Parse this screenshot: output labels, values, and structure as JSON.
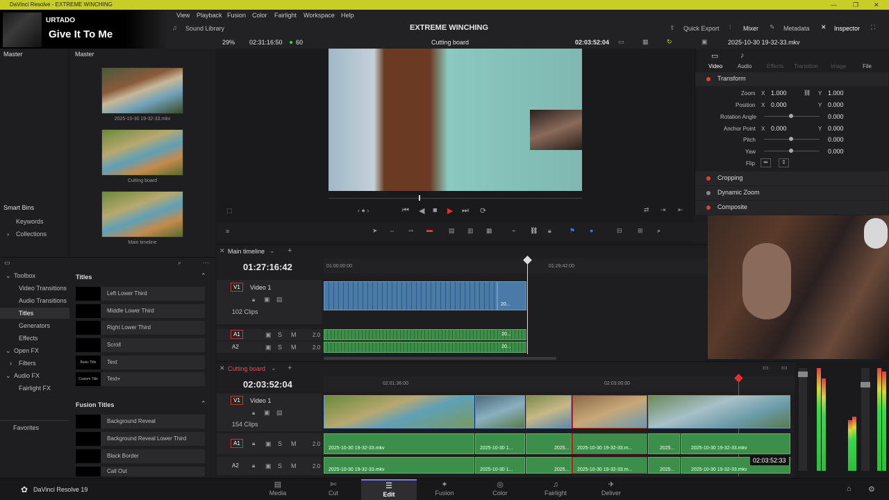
{
  "window": {
    "title": "DaVinci Resolve - EXTREME WINCHING"
  },
  "music": {
    "artist": "URTADO",
    "song": "Give It To Me"
  },
  "menu": {
    "items": [
      "View",
      "Playback",
      "Fusion",
      "Color",
      "Fairlight",
      "Workspace",
      "Help"
    ]
  },
  "toolbar": {
    "sound_library": "Sound Library",
    "project_title": "EXTREME WINCHING",
    "quick_export": "Quick Export",
    "mixer": "Mixer",
    "metadata": "Metadata",
    "inspector": "Inspector"
  },
  "media": {
    "master_left": "Master",
    "master_right": "Master",
    "smart_bins": "Smart Bins",
    "keywords": "Keywords",
    "collections": "Collections",
    "thumbs": [
      "2025-10-30 19-32-33.mkv",
      "Cutting board",
      "Main timeline"
    ]
  },
  "viewer": {
    "zoom": "29%",
    "source_tc": "02:31:16:50",
    "fps": "60",
    "name": "Cutting board",
    "record_tc": "02:03:52:04",
    "clip_name": "2025-10-30 19-32-33.mkv"
  },
  "inspector": {
    "tabs": [
      "Video",
      "Audio",
      "Effects",
      "Transition",
      "Image",
      "File"
    ],
    "sections": [
      "Transform",
      "Cropping",
      "Dynamic Zoom",
      "Composite"
    ],
    "zoom_label": "Zoom",
    "zoom_x": "1.000",
    "zoom_y": "1.000",
    "position_label": "Position",
    "pos_x": "0.000",
    "pos_y": "0.000",
    "rotation_label": "Rotation Angle",
    "rotation": "0.000",
    "anchor_label": "Anchor Point",
    "anchor_x": "0.000",
    "anchor_y": "0.000",
    "pitch_label": "Pitch",
    "pitch": "0.000",
    "yaw_label": "Yaw",
    "yaw": "0.000",
    "flip_label": "Flip",
    "x": "X",
    "y": "Y"
  },
  "toolbox": {
    "items": [
      "Toolbox",
      "Video Transitions",
      "Audio Transitions",
      "Titles",
      "Generators",
      "Effects",
      "Open FX",
      "Filters",
      "Audio FX",
      "Fairlight FX",
      "Favorites"
    ]
  },
  "titles": {
    "header": "Titles",
    "items": [
      "Left Lower Third",
      "Middle Lower Third",
      "Right Lower Third",
      "Scroll",
      "Text",
      "Text+"
    ],
    "thumbs": [
      "",
      "",
      "",
      "",
      "Basic Title",
      "Custom Title"
    ],
    "fusion_header": "Fusion Titles",
    "fusion_items": [
      "Background Reveal",
      "Background Reveal Lower Third",
      "Black Border",
      "Call Out"
    ]
  },
  "main_timeline": {
    "tab": "Main timeline",
    "tc": "01:27:16:42",
    "ruler": [
      "01:00:00:00",
      "01:29:42:00"
    ],
    "v1": "V1",
    "video1": "Video 1",
    "clips": "102 Clips",
    "a1": "A1",
    "a2": "A2",
    "vol": "2.0",
    "clip_label": "20..."
  },
  "cutting_board": {
    "tab": "Cutting board",
    "tc": "02:03:52:04",
    "ruler": [
      "02:01:36:00",
      "02:03:00:00"
    ],
    "v1": "V1",
    "video1": "Video 1",
    "clips": "154 Clips",
    "a1": "A1",
    "a2": "A2",
    "vol": "2.0",
    "clip_labels": [
      "2025-10-30 19-32-33.mkv",
      "2025-10-30 1...",
      "2025...",
      "2025-10-30 19-32-33.m...",
      "2025...",
      "2025-10-30 19-32-33.mkv"
    ],
    "hover_tc": "02:03:52:33"
  },
  "pages": {
    "app": "DaVinci Resolve 19",
    "tabs": [
      "Media",
      "Cut",
      "Edit",
      "Fusion",
      "Color",
      "Fairlight",
      "Deliver"
    ],
    "active": "Edit"
  },
  "colors": {
    "accent": "#7a7af0",
    "video_clip": "#4a7aa8",
    "audio_clip": "#3c8f4a",
    "title_bar": "#c9cd27",
    "playhead": "#e03030"
  }
}
